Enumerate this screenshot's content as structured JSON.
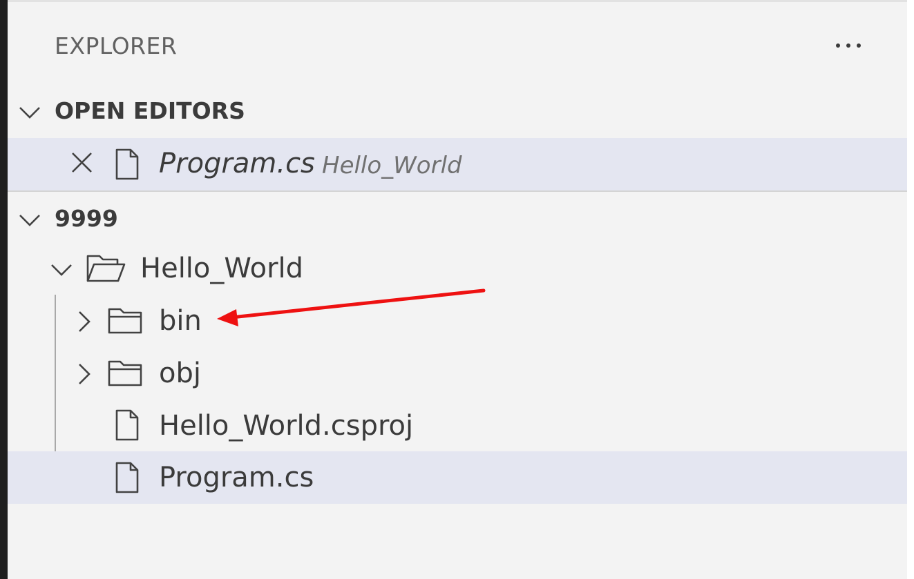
{
  "explorer": {
    "title": "EXPLORER",
    "more_icon": "ellipsis-icon"
  },
  "open_editors": {
    "header": "OPEN EDITORS",
    "items": [
      {
        "name": "Program.cs",
        "description": "Hello_World",
        "close_icon": "close-icon",
        "file_icon": "file-icon"
      }
    ]
  },
  "workspace": {
    "header": "9999",
    "tree": [
      {
        "label": "Hello_World",
        "type": "folder-open",
        "expanded": true
      },
      {
        "label": "bin",
        "type": "folder",
        "expanded": false
      },
      {
        "label": "obj",
        "type": "folder",
        "expanded": false
      },
      {
        "label": "Hello_World.csproj",
        "type": "file"
      },
      {
        "label": "Program.cs",
        "type": "file",
        "selected": true
      }
    ]
  },
  "colors": {
    "panel_bg": "#f3f3f3",
    "selection_bg": "#e4e6f1",
    "annotation_arrow": "#ee1111"
  }
}
